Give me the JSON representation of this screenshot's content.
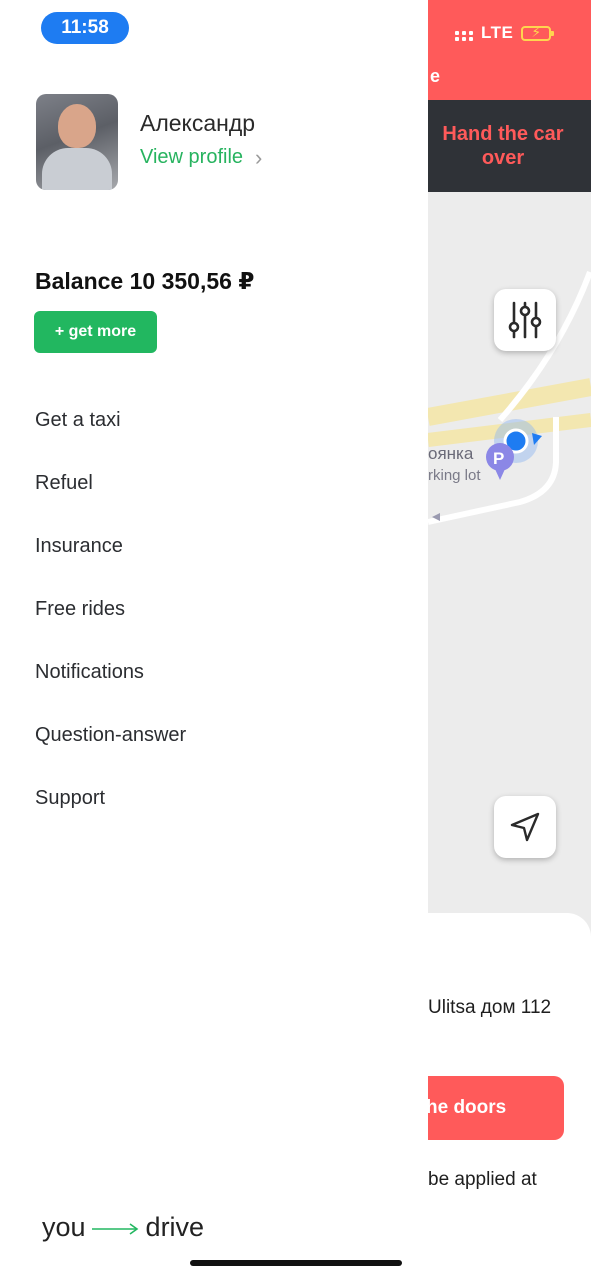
{
  "status_bar": {
    "time": "11:58",
    "network": "LTE"
  },
  "background_app": {
    "header_fragment": "e",
    "hand_over_button": "Hand the car over",
    "map_label_1": "оянка",
    "map_label_2": "rking lot",
    "address_fragment": "Ulitsa дом 112",
    "doors_button_fragment": "he doors",
    "applied_fragment": "be applied at"
  },
  "drawer": {
    "user": {
      "name": "Александр",
      "view_profile": "View profile"
    },
    "balance": "Balance 10 350,56 ₽",
    "get_more": "+ get more",
    "menu": [
      "Get a taxi",
      "Refuel",
      "Insurance",
      "Free rides",
      "Notifications",
      "Question-answer",
      "Support"
    ],
    "logo": {
      "left": "you",
      "right": "drive"
    }
  },
  "colors": {
    "accent_green": "#22b760",
    "accent_red": "#ff5a5a",
    "dark_bar": "#2f3237",
    "time_pill": "#1e7cf2"
  }
}
